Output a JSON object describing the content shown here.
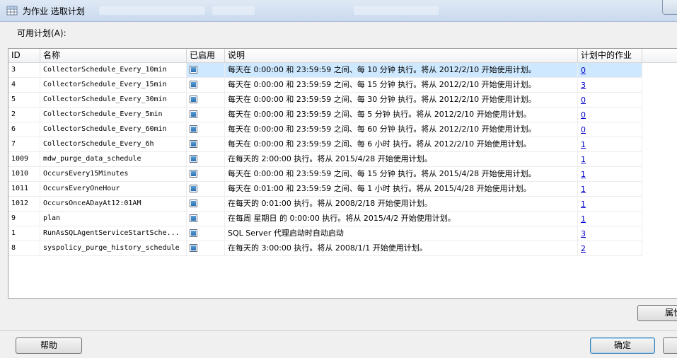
{
  "window": {
    "title": "为作业 选取计划"
  },
  "available_label": "可用计划(A):",
  "columns": [
    "ID",
    "名称",
    "已启用",
    "说明",
    "计划中的作业"
  ],
  "rows": [
    {
      "id": "3",
      "name": "CollectorSchedule_Every_10min",
      "enabled": true,
      "desc": "每天在 0:00:00 和 23:59:59 之间、每 10 分钟 执行。将从 2012/2/10 开始使用计划。",
      "jobs": "0",
      "selected": true
    },
    {
      "id": "4",
      "name": "CollectorSchedule_Every_15min",
      "enabled": true,
      "desc": "每天在 0:00:00 和 23:59:59 之间、每 15 分钟 执行。将从 2012/2/10 开始使用计划。",
      "jobs": "3"
    },
    {
      "id": "5",
      "name": "CollectorSchedule_Every_30min",
      "enabled": true,
      "desc": "每天在 0:00:00 和 23:59:59 之间、每 30 分钟 执行。将从 2012/2/10 开始使用计划。",
      "jobs": "0"
    },
    {
      "id": "2",
      "name": "CollectorSchedule_Every_5min",
      "enabled": true,
      "desc": "每天在 0:00:00 和 23:59:59 之间、每 5 分钟 执行。将从 2012/2/10 开始使用计划。",
      "jobs": "0"
    },
    {
      "id": "6",
      "name": "CollectorSchedule_Every_60min",
      "enabled": true,
      "desc": "每天在 0:00:00 和 23:59:59 之间、每 60 分钟 执行。将从 2012/2/10 开始使用计划。",
      "jobs": "0"
    },
    {
      "id": "7",
      "name": "CollectorSchedule_Every_6h",
      "enabled": true,
      "desc": "每天在 0:00:00 和 23:59:59 之间、每 6 小时 执行。将从 2012/2/10 开始使用计划。",
      "jobs": "1"
    },
    {
      "id": "1009",
      "name": "mdw_purge_data_schedule",
      "enabled": true,
      "desc": "在每天的 2:00:00 执行。将从 2015/4/28 开始使用计划。",
      "jobs": "1"
    },
    {
      "id": "1010",
      "name": "OccursEvery15Minutes",
      "enabled": true,
      "desc": "每天在 0:00:00 和 23:59:59 之间、每 15 分钟 执行。将从 2015/4/28 开始使用计划。",
      "jobs": "1"
    },
    {
      "id": "1011",
      "name": "OccursEveryOneHour",
      "enabled": true,
      "desc": "每天在 0:01:00 和 23:59:59 之间、每 1 小时 执行。将从 2015/4/28 开始使用计划。",
      "jobs": "1"
    },
    {
      "id": "1012",
      "name": "OccursOnceADayAt12:01AM",
      "enabled": true,
      "desc": "在每天的 0:01:00 执行。将从 2008/2/18 开始使用计划。",
      "jobs": "1"
    },
    {
      "id": "9",
      "name": "plan",
      "enabled": true,
      "desc": "在每周 星期日 的 0:00:00 执行。将从 2015/4/2 开始使用计划。",
      "jobs": "1"
    },
    {
      "id": "1",
      "name": "RunAsSQLAgentServiceStartSche...",
      "enabled": true,
      "desc": "SQL Server 代理启动时自动启动",
      "jobs": "3"
    },
    {
      "id": "8",
      "name": "syspolicy_purge_history_schedule",
      "enabled": true,
      "desc": "在每天的 3:00:00 执行。将从 2008/1/1 开始使用计划。",
      "jobs": "2"
    }
  ],
  "buttons": {
    "properties": "属性",
    "help": "帮助",
    "ok": "确定"
  },
  "colors": {
    "selection": "#cde8ff",
    "link": "#0000cc",
    "checkbox_fill": "#2a6fb2"
  }
}
